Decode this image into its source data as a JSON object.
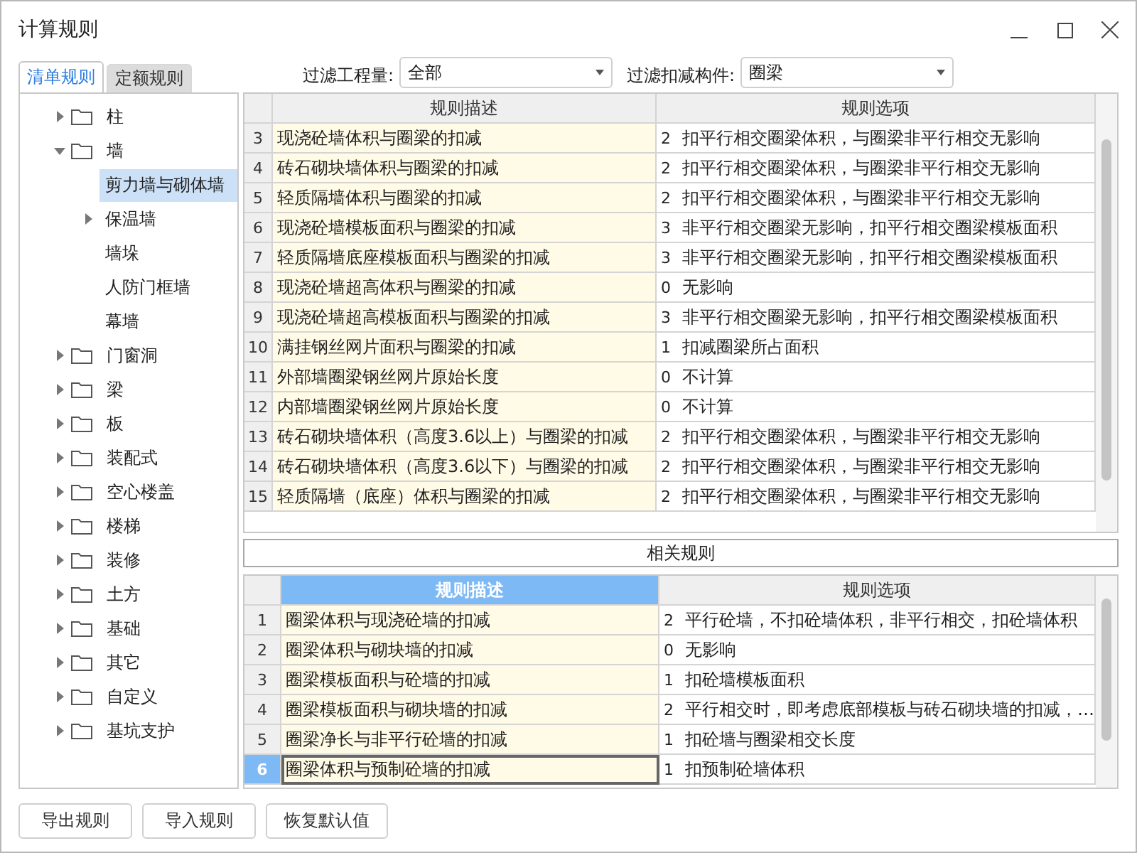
{
  "window": {
    "title": "计算规则"
  },
  "tabs": [
    {
      "label": "清单规则",
      "selected": true
    },
    {
      "label": "定额规则",
      "selected": false
    }
  ],
  "filters": [
    {
      "label": "过滤工程量:",
      "value": "全部"
    },
    {
      "label": "过滤扣减构件:",
      "value": "圈梁"
    }
  ],
  "tree": [
    {
      "label": "柱",
      "expanded": false
    },
    {
      "label": "墙",
      "expanded": true,
      "children": [
        {
          "label": "剪力墙与砌体墙",
          "selected": true
        },
        {
          "label": "保温墙",
          "expanded": false,
          "selected": false
        },
        {
          "label": "墙垛",
          "selected": false
        },
        {
          "label": "人防门框墙",
          "selected": false
        },
        {
          "label": "幕墙",
          "selected": false
        }
      ]
    },
    {
      "label": "门窗洞",
      "expanded": false
    },
    {
      "label": "梁",
      "expanded": false
    },
    {
      "label": "板",
      "expanded": false
    },
    {
      "label": "装配式",
      "expanded": false
    },
    {
      "label": "空心楼盖",
      "expanded": false
    },
    {
      "label": "楼梯",
      "expanded": false
    },
    {
      "label": "装修",
      "expanded": false
    },
    {
      "label": "土方",
      "expanded": false
    },
    {
      "label": "基础",
      "expanded": false
    },
    {
      "label": "其它",
      "expanded": false
    },
    {
      "label": "自定义",
      "expanded": false
    },
    {
      "label": "基坑支护",
      "expanded": false
    }
  ],
  "rules_table": {
    "columns": [
      {
        "label": "规则描述",
        "selected": false
      },
      {
        "label": "规则选项",
        "selected": false
      }
    ],
    "rows": [
      {
        "no": "3",
        "description": "现浇砼墙体积与圈梁的扣减",
        "code": "2",
        "option": "扣平行相交圈梁体积，与圈梁非平行相交无影响"
      },
      {
        "no": "4",
        "description": "砖石砌块墙体积与圈梁的扣减",
        "code": "2",
        "option": "扣平行相交圈梁体积，与圈梁非平行相交无影响"
      },
      {
        "no": "5",
        "description": "轻质隔墙体积与圈梁的扣减",
        "code": "2",
        "option": "扣平行相交圈梁体积，与圈梁非平行相交无影响"
      },
      {
        "no": "6",
        "description": "现浇砼墙模板面积与圈梁的扣减",
        "code": "3",
        "option": "非平行相交圈梁无影响，扣平行相交圈梁模板面积"
      },
      {
        "no": "7",
        "description": "轻质隔墙底座模板面积与圈梁的扣减",
        "code": "3",
        "option": "非平行相交圈梁无影响，扣平行相交圈梁模板面积"
      },
      {
        "no": "8",
        "description": "现浇砼墙超高体积与圈梁的扣减",
        "code": "0",
        "option": "无影响"
      },
      {
        "no": "9",
        "description": "现浇砼墙超高模板面积与圈梁的扣减",
        "code": "3",
        "option": "非平行相交圈梁无影响，扣平行相交圈梁模板面积"
      },
      {
        "no": "10",
        "description": "满挂钢丝网片面积与圈梁的扣减",
        "code": "1",
        "option": "扣减圈梁所占面积"
      },
      {
        "no": "11",
        "description": "外部墙圈梁钢丝网片原始长度",
        "code": "0",
        "option": "不计算"
      },
      {
        "no": "12",
        "description": "内部墙圈梁钢丝网片原始长度",
        "code": "0",
        "option": "不计算"
      },
      {
        "no": "13",
        "description": "砖石砌块墙体积（高度3.6以上）与圈梁的扣减",
        "code": "2",
        "option": "扣平行相交圈梁体积，与圈梁非平行相交无影响"
      },
      {
        "no": "14",
        "description": "砖石砌块墙体积（高度3.6以下）与圈梁的扣减",
        "code": "2",
        "option": "扣平行相交圈梁体积，与圈梁非平行相交无影响"
      },
      {
        "no": "15",
        "description": "轻质隔墙（底座）体积与圈梁的扣减",
        "code": "2",
        "option": "扣平行相交圈梁体积，与圈梁非平行相交无影响"
      }
    ]
  },
  "related_title": "相关规则",
  "related_table": {
    "columns": [
      {
        "label": "规则描述",
        "selected": true
      },
      {
        "label": "规则选项",
        "selected": false
      }
    ],
    "rows": [
      {
        "no": "1",
        "description": "圈梁体积与现浇砼墙的扣减",
        "code": "2",
        "option": "平行砼墙，不扣砼墙体积，非平行相交，扣砼墙体积",
        "selected": false
      },
      {
        "no": "2",
        "description": "圈梁体积与砌块墙的扣减",
        "code": "0",
        "option": "无影响",
        "selected": false
      },
      {
        "no": "3",
        "description": "圈梁模板面积与砼墙的扣减",
        "code": "1",
        "option": "扣砼墙模板面积",
        "selected": false
      },
      {
        "no": "4",
        "description": "圈梁模板面积与砌块墙的扣减",
        "code": "2",
        "option": "平行相交时，即考虑底部模板与砖石砌块墙的扣减，…",
        "selected": false
      },
      {
        "no": "5",
        "description": "圈梁净长与非平行砼墙的扣减",
        "code": "1",
        "option": "扣砼墙与圈梁相交长度",
        "selected": false
      },
      {
        "no": "6",
        "description": "圈梁体积与预制砼墙的扣减",
        "code": "1",
        "option": "扣预制砼墙体积",
        "selected": true
      }
    ]
  },
  "buttons": [
    "导出规则",
    "导入规则",
    "恢复默认值"
  ]
}
